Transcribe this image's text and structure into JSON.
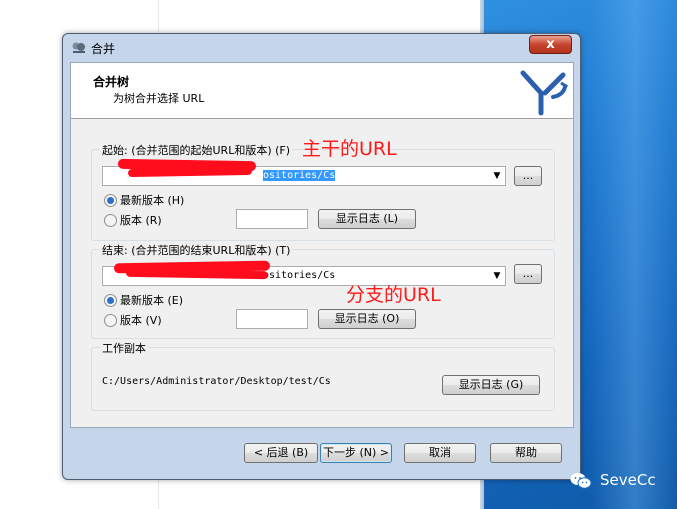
{
  "dialog": {
    "title": "合并",
    "close_label": "x",
    "header_title": "合并树",
    "header_subtitle": "为树合并选择 URL"
  },
  "start": {
    "group_label": "起始: (合并范围的起始URL和版本) (F)",
    "url_visible": "ositories/Cs",
    "browse_label": "...",
    "latest_label": "最新版本 (H)",
    "revision_label": "版本 (R)",
    "revision_value": "",
    "show_log_label": "显示日志 (L)",
    "latest_checked": true
  },
  "end": {
    "group_label": "结束: (合并范围的结束URL和版本) (T)",
    "url_visible": "ositories/Cs",
    "browse_label": "...",
    "latest_label": "最新版本 (E)",
    "revision_label": "版本 (V)",
    "revision_value": "",
    "show_log_label": "显示日志 (O)",
    "latest_checked": true
  },
  "working_copy": {
    "group_label": "工作副本",
    "path": "C:/Users/Administrator/Desktop/test/Cs",
    "show_log_label": "显示日志 (G)"
  },
  "footer": {
    "back_label": "< 后退 (B)",
    "next_label": "下一步 (N) >",
    "cancel_label": "取消",
    "help_label": "帮助"
  },
  "annotations": {
    "trunk_url": "主干的URL",
    "branch_url": "分支的URL"
  },
  "watermark": {
    "text": "SeveCc"
  },
  "colors": {
    "annotation": "#ff1a1a",
    "redaction": "#ff0d1d",
    "selection": "#3399ff"
  },
  "icons": {
    "title": "merge-icon",
    "header": "tortoise-merge-logo",
    "watermark": "wechat-icon"
  }
}
